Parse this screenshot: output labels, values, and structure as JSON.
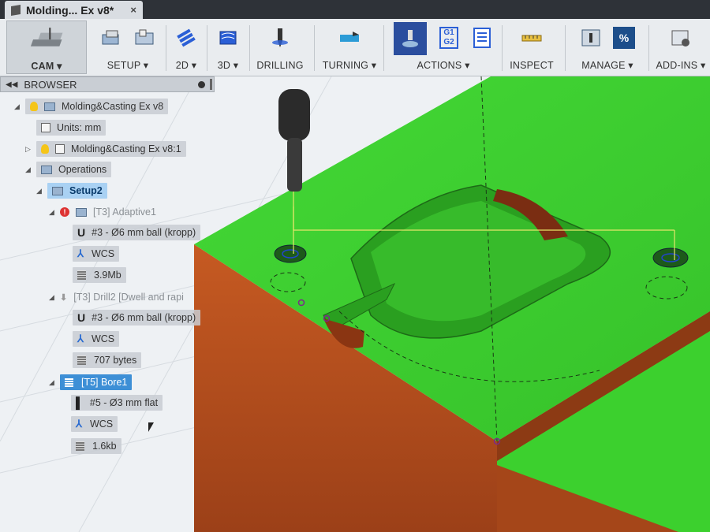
{
  "window": {
    "tab_title": "Molding... Ex v8*",
    "close": "×"
  },
  "toolbar": {
    "groups": [
      {
        "id": "cam",
        "label": "CAM ▾"
      },
      {
        "id": "setup",
        "label": "SETUP ▾"
      },
      {
        "id": "2d",
        "label": "2D ▾"
      },
      {
        "id": "3d",
        "label": "3D ▾"
      },
      {
        "id": "drilling",
        "label": "DRILLING"
      },
      {
        "id": "turning",
        "label": "TURNING ▾"
      },
      {
        "id": "actions",
        "label": "ACTIONS ▾"
      },
      {
        "id": "inspect",
        "label": "INSPECT"
      },
      {
        "id": "manage",
        "label": "MANAGE ▾"
      },
      {
        "id": "addins",
        "label": "ADD-INS ▾"
      }
    ],
    "g1g2_icon_text": "G1 G2",
    "percent_icon_text": "%"
  },
  "browser": {
    "title": "BROWSER",
    "root": "Molding&Casting Ex v8",
    "units": "Units: mm",
    "component": "Molding&Casting Ex v8:1",
    "operations": "Operations",
    "setup": "Setup2",
    "op1": {
      "name": "[T3] Adaptive1",
      "tool": "#3 - Ø6 mm ball (kropp)",
      "wcs": "WCS",
      "size": "3.9Mb"
    },
    "op2": {
      "name": "[T3] Drill2 [Dwell and rapi",
      "tool": "#3 - Ø6 mm ball (kropp)",
      "wcs": "WCS",
      "size": "707 bytes"
    },
    "op3": {
      "name": "[T5] Bore1",
      "tool": "#5 - Ø3 mm flat",
      "wcs": "WCS",
      "size": "1.6kb"
    }
  },
  "colors": {
    "stock_top": "#3fd431",
    "stock_side": "#b5501f",
    "accent": "#3d8fd6"
  }
}
